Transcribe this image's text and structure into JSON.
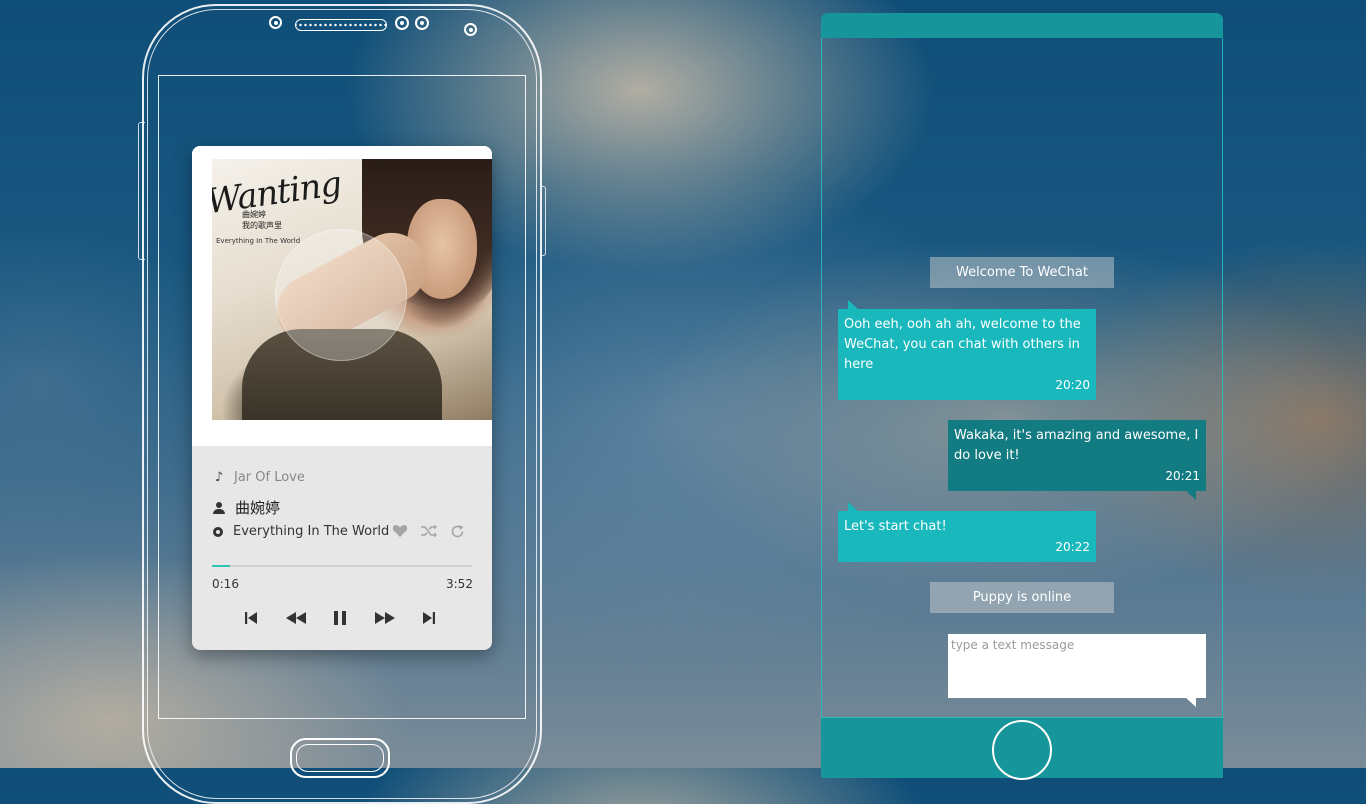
{
  "music_player": {
    "album_art": {
      "title_script": "Wanting",
      "cn_line1": "曲婉婷",
      "cn_line2": "我的歌声里",
      "subtitle": "Everything In The World"
    },
    "song": "Jar Of Love",
    "artist": "曲婉婷",
    "album": "Everything In The World",
    "current_time": "0:16",
    "total_time": "3:52",
    "progress": 0.07,
    "accent_color": "#2ec5b4",
    "icons": {
      "song": "music-note-icon",
      "artist": "person-icon",
      "album": "disc-icon",
      "like": "heart-icon",
      "shuffle": "shuffle-icon",
      "repeat": "repeat-icon",
      "prev": "skip-previous-icon",
      "rewind": "rewind-icon",
      "pause": "pause-icon",
      "forward": "fast-forward-icon",
      "next": "skip-next-icon"
    }
  },
  "chat": {
    "header_color": "#16969a",
    "welcome": "Welcome To WeChat",
    "messages": [
      {
        "side": "left",
        "text": "Ooh eeh, ooh ah ah, welcome to the WeChat, you can chat with others in here",
        "time": "20:20"
      },
      {
        "side": "right",
        "text": "Wakaka, it's amazing and awesome, I do love it!",
        "time": "20:21"
      },
      {
        "side": "left",
        "text": "Let's start chat!",
        "time": "20:22"
      }
    ],
    "status": "Puppy is online",
    "input": {
      "placeholder": "type a text message",
      "value": ""
    }
  }
}
